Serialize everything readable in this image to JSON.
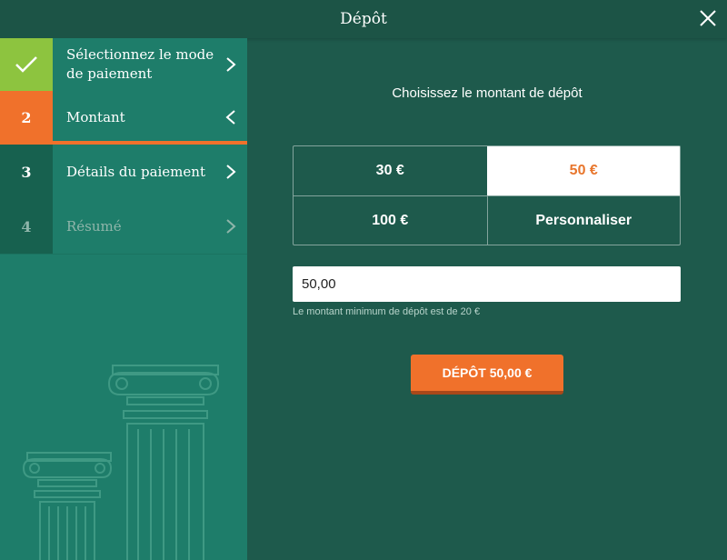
{
  "header": {
    "title": "Dépôt",
    "close_icon": "close-icon"
  },
  "steps": [
    {
      "marker": "✓",
      "label": "Sélectionnez le mode de paiement",
      "chevron": "chevron-right-icon",
      "state": "done",
      "marker_bg": "#8dc43f",
      "row_bg": "#1e7d6a"
    },
    {
      "marker": "2",
      "label": "Montant",
      "chevron": "chevron-left-icon",
      "state": "active",
      "marker_bg": "#f0712b",
      "row_bg": "#1e7d6a"
    },
    {
      "marker": "3",
      "label": "Détails du paiement",
      "chevron": "chevron-right-icon",
      "state": "pending",
      "marker_bg": "#17614f",
      "row_bg": "#1e7d6a"
    },
    {
      "marker": "4",
      "label": "Résumé",
      "chevron": "chevron-right-icon",
      "state": "disabled",
      "marker_bg": "#17614f",
      "row_bg": "#1e7d6a"
    }
  ],
  "main": {
    "prompt": "Choisissez le montant de dépôt",
    "amounts": [
      {
        "label": "30 €",
        "selected": false
      },
      {
        "label": "50 €",
        "selected": true
      },
      {
        "label": "100 €",
        "selected": false
      },
      {
        "label": "Personnaliser",
        "selected": false
      }
    ],
    "amount_input_value": "50,00",
    "hint": "Le montant minimum de dépôt est de 20 €",
    "deposit_button": "DÉPÔT 50,00 €"
  },
  "colors": {
    "background": "#1e5a4c",
    "sidebar": "#1e7d6a",
    "accent": "#f0712b",
    "done": "#8dc43f"
  }
}
